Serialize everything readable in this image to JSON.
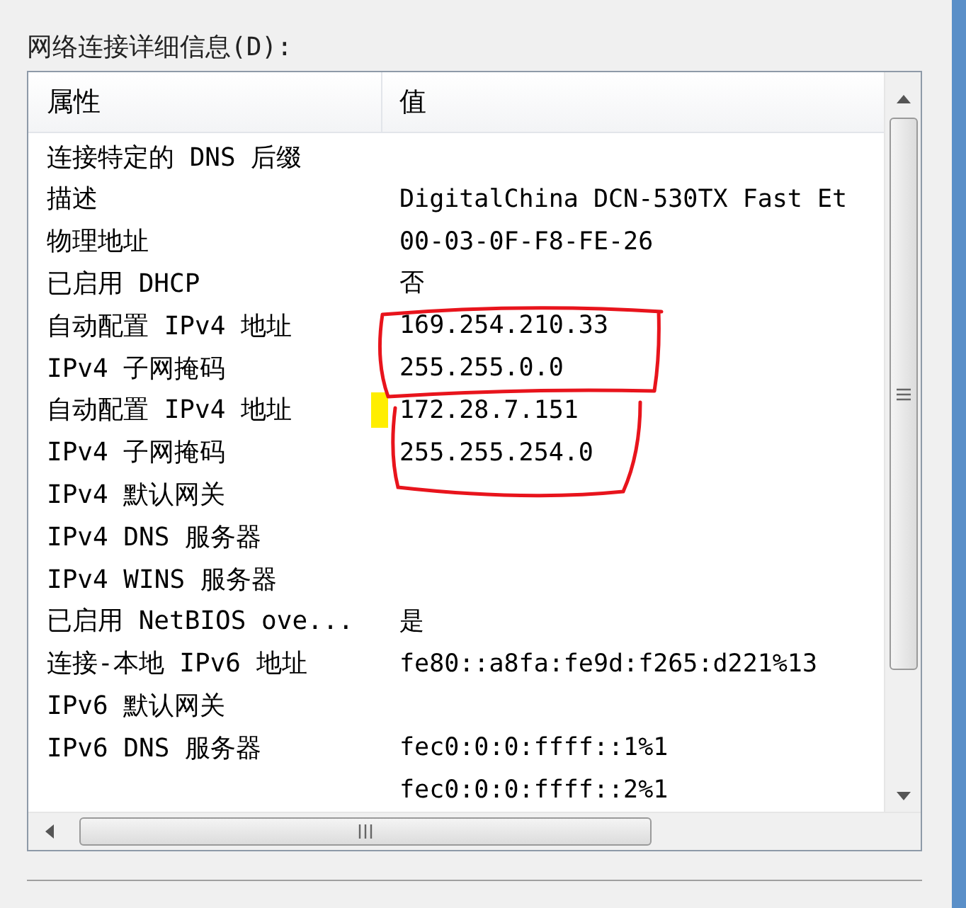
{
  "group_label": "网络连接详细信息(D):",
  "columns": [
    "属性",
    "值"
  ],
  "rows": [
    {
      "property": "连接特定的 DNS 后缀",
      "value": ""
    },
    {
      "property": "描述",
      "value": "DigitalChina DCN-530TX Fast Et"
    },
    {
      "property": "物理地址",
      "value": "00-03-0F-F8-FE-26"
    },
    {
      "property": "已启用 DHCP",
      "value": "否"
    },
    {
      "property": "自动配置 IPv4 地址",
      "value": "169.254.210.33"
    },
    {
      "property": "IPv4 子网掩码",
      "value": "255.255.0.0"
    },
    {
      "property": "自动配置 IPv4 地址",
      "value": "172.28.7.151"
    },
    {
      "property": "IPv4 子网掩码",
      "value": "255.255.254.0"
    },
    {
      "property": "IPv4 默认网关",
      "value": ""
    },
    {
      "property": "IPv4 DNS 服务器",
      "value": ""
    },
    {
      "property": "IPv4 WINS 服务器",
      "value": ""
    },
    {
      "property": "已启用 NetBIOS ove...",
      "value": "是"
    },
    {
      "property": "连接-本地 IPv6 地址",
      "value": "fe80::a8fa:fe9d:f265:d221%13"
    },
    {
      "property": "IPv6 默认网关",
      "value": ""
    },
    {
      "property": "IPv6 DNS 服务器",
      "value": "fec0:0:0:ffff::1%1"
    },
    {
      "property": "",
      "value": "fec0:0:0:ffff::2%1"
    }
  ]
}
